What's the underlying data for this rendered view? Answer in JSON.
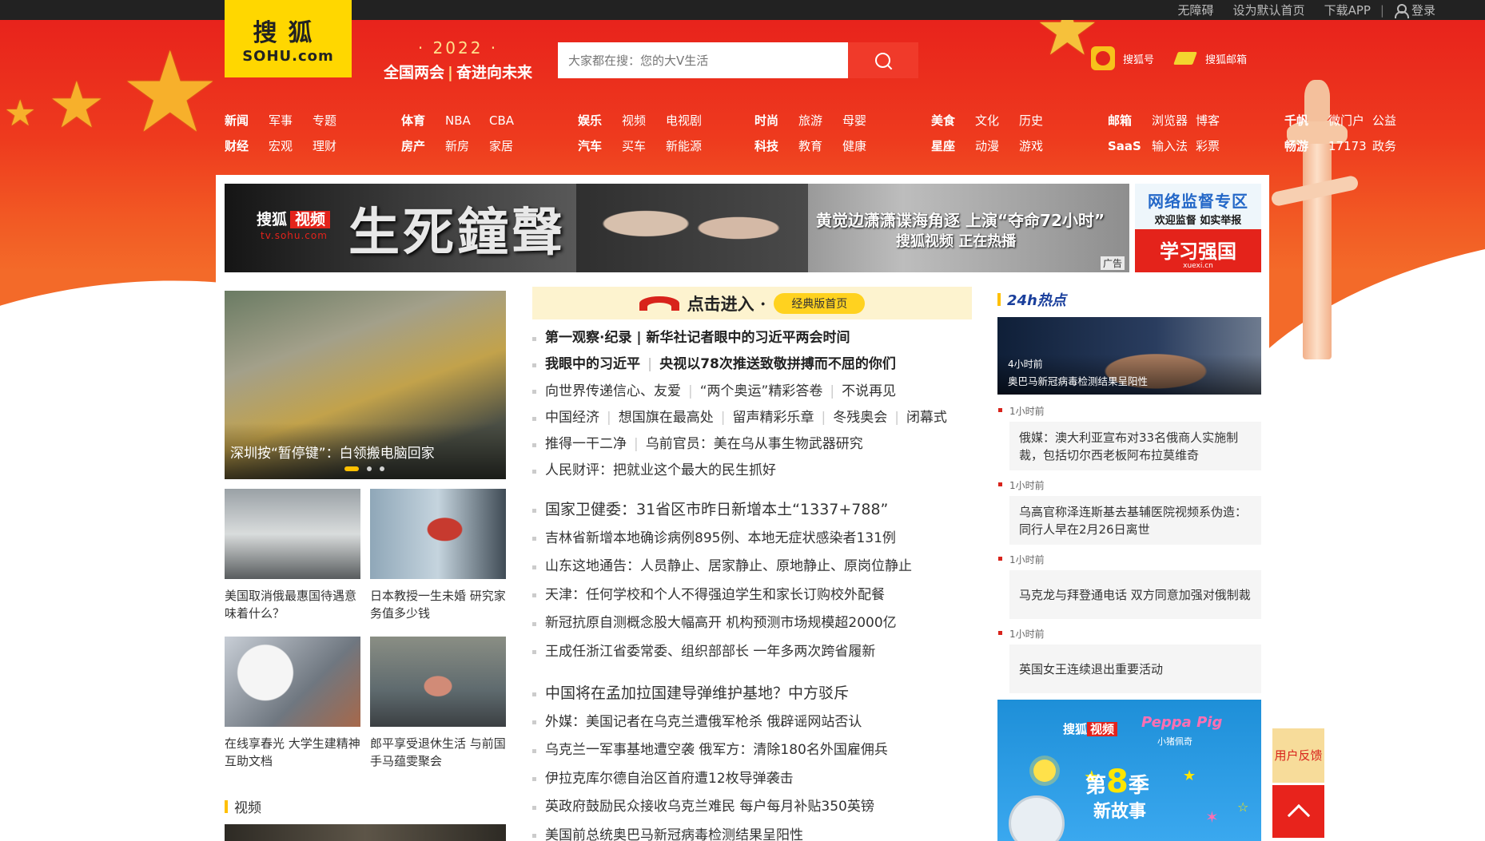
{
  "topbar": {
    "links": [
      "无障碍",
      "设为默认首页",
      "下载APP"
    ],
    "login": "登录"
  },
  "logo": {
    "line1": "搜狐",
    "line2": "SOHU.com"
  },
  "slogan": {
    "year": "· 2022 ·",
    "left": "全国两会",
    "right": "奋进向未来"
  },
  "search": {
    "placeholder": "大家都在搜：您的大V生活"
  },
  "header_links": [
    {
      "label": "搜狐号",
      "icon": "sohu-hao-icon"
    },
    {
      "label": "搜狐邮箱",
      "icon": "mail-icon"
    }
  ],
  "nav": {
    "groups": [
      {
        "row1": [
          "新闻",
          "军事",
          "专题"
        ],
        "row2": [
          "财经",
          "宏观",
          "理财"
        ]
      },
      {
        "row1": [
          "体育",
          "NBA",
          "CBA"
        ],
        "row2": [
          "房产",
          "新房",
          "家居"
        ]
      },
      {
        "row1": [
          "娱乐",
          "视频",
          "电视剧"
        ],
        "row2": [
          "汽车",
          "买车",
          "新能源"
        ]
      },
      {
        "row1": [
          "时尚",
          "旅游",
          "母婴"
        ],
        "row2": [
          "科技",
          "教育",
          "健康"
        ]
      },
      {
        "row1": [
          "美食",
          "文化",
          "历史"
        ],
        "row2": [
          "星座",
          "动漫",
          "游戏"
        ]
      },
      {
        "row1": [
          "邮箱",
          "浏览器",
          "博客"
        ],
        "row2": [
          "SaaS",
          "输入法",
          "彩票"
        ]
      },
      {
        "row1": [
          "千帆",
          "微门户",
          "公益"
        ],
        "row2": [
          "畅游",
          "17173",
          "政务"
        ]
      }
    ]
  },
  "banner": {
    "brand": "搜狐",
    "brand_tag": "视频",
    "brand_url": "tv.sohu.com",
    "title": "生死鐘聲",
    "line1": "黄觉边潇潇谍海角逐 上演“夺命72小时”",
    "line2": "搜狐视频 正在热播",
    "ad": "广告"
  },
  "side_ad": {
    "t1": "网络监督专区",
    "t2": "欢迎监督 如实举报",
    "t3": "学习强国",
    "t4": "xuexi.cn"
  },
  "slider": {
    "caption": "深圳按“暂停键”：白领搬电脑回家"
  },
  "thumbs": [
    {
      "text": "美国取消俄最惠国待遇意味着什么？"
    },
    {
      "text": "日本教授一生未婚 研究家务值多少钱"
    },
    {
      "text": "在线享春光 大学生建精神互助文档"
    },
    {
      "text": "郎平享受退休生活 与前国手马蕴雯聚会"
    }
  ],
  "video_section": {
    "title": "视频"
  },
  "classic": {
    "enter": "点击进入 ·",
    "pill": "经典版首页"
  },
  "news1": [
    {
      "text": "第一观察·纪录 | 新华社记者眼中的习近平两会时间",
      "bold": true
    },
    {
      "parts": [
        "我眼中的习近平",
        "央视以78次推送致敬拼搏而不屈的你们"
      ],
      "bold": true
    },
    {
      "parts": [
        "向世界传递信心、友爱",
        "“两个奥运”精彩答卷",
        "不说再见"
      ]
    },
    {
      "parts": [
        "中国经济",
        "想国旗在最高处",
        "留声精彩乐章",
        "冬残奥会",
        "闭幕式"
      ]
    },
    {
      "parts": [
        "推得一干二净",
        "乌前官员：美在乌从事生物武器研究"
      ]
    },
    {
      "text": "人民财评：把就业这个最大的民生抓好"
    }
  ],
  "news2": [
    {
      "text": "国家卫健委：31省区市昨日新增本土“1337+788”",
      "lead": true
    },
    {
      "text": "吉林省新增本地确诊病例895例、本地无症状感染者131例"
    },
    {
      "text": "山东这地通告：人员静止、居家静止、原地静止、原岗位静止"
    },
    {
      "text": "天津：任何学校和个人不得强迫学生和家长订购校外配餐"
    },
    {
      "text": "新冠抗原自测概念股大幅高开 机构预测市场规模超2000亿"
    },
    {
      "text": "王成任浙江省委常委、组织部部长 一年多两次跨省履新"
    }
  ],
  "news3": [
    {
      "text": "中国将在孟加拉国建导弹维护基地？中方驳斥",
      "lead": true
    },
    {
      "text": "外媒：美国记者在乌克兰遭俄军枪杀 俄辟谣网站否认"
    },
    {
      "text": "乌克兰一军事基地遭空袭 俄军方：清除180名外国雇佣兵"
    },
    {
      "text": "伊拉克库尔德自治区首府遭12枚导弹袭击"
    },
    {
      "text": "英政府鼓励民众接收乌克兰难民 每户每月补贴350英镑"
    },
    {
      "text": "美国前总统奥巴马新冠病毒检测结果呈阳性"
    }
  ],
  "hot": {
    "title": "24h热点",
    "top": {
      "time": "4小时前",
      "caption": "奥巴马新冠病毒检测结果呈阳性"
    },
    "items": [
      {
        "time": "1小时前",
        "text": "俄媒：澳大利亚宣布对33名俄商人实施制裁，包括切尔西老板阿布拉莫维奇"
      },
      {
        "time": "1小时前",
        "text": "乌高官称泽连斯基去基辅医院视频系伪造：同行人早在2月26日离世"
      },
      {
        "time": "1小时前",
        "text": "马克龙与拜登通电话 双方同意加强对俄制裁"
      },
      {
        "time": "1小时前",
        "text": "英国女王连续退出重要活动"
      }
    ]
  },
  "peppa": {
    "brand": "搜狐",
    "brand_tag": "视频",
    "pp": "Peppa Pig",
    "pp_sub": "小猪佩奇",
    "season_pre": "第",
    "season_num": "8",
    "season_post": "季",
    "sub": "新故事"
  },
  "float": {
    "feedback": "用户反馈"
  },
  "colors": {
    "brand_red": "#e8231c",
    "brand_yellow": "#ffd700",
    "accent_yellow": "#ffc000",
    "hot_blue": "#1a3f9c"
  }
}
